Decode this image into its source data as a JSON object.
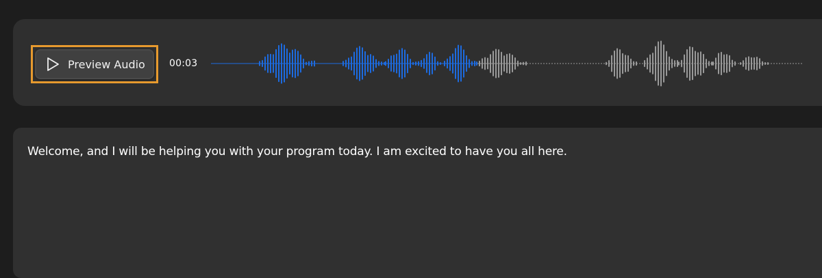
{
  "player": {
    "preview_button_label": "Preview Audio",
    "preview_icon": "play-icon",
    "elapsed_time": "00:03",
    "progress_fraction": 0.44,
    "played_color": "#1d6be0",
    "unplayed_color": "#9a9a9a",
    "highlight_color": "#e79a2e"
  },
  "transcript": {
    "text": "Welcome, and I will be helping you with your program today. I am excited to have you all here."
  }
}
